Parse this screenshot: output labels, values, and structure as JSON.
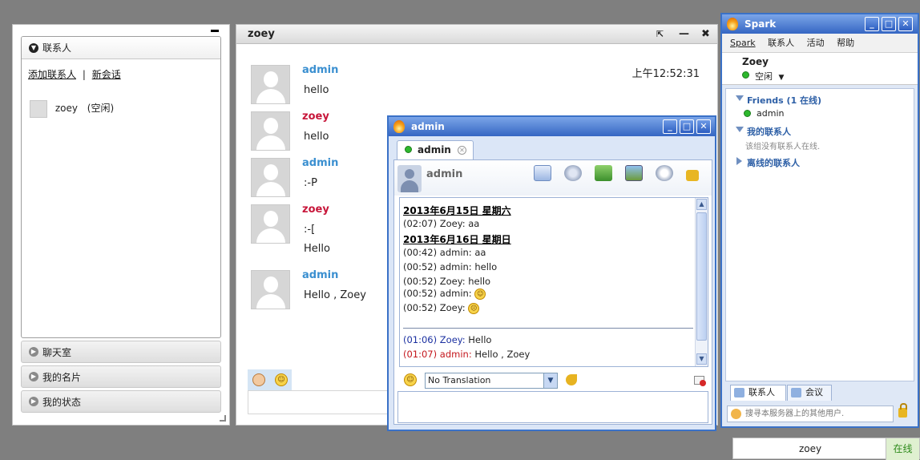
{
  "left_panel": {
    "contacts_header": "联系人",
    "add_contact_link": "添加联系人",
    "separator": "|",
    "new_session_link": "新会话",
    "contact": {
      "name": "zoey",
      "status": "(空闲)"
    },
    "sections": [
      "聊天室",
      "我的名片",
      "我的状态"
    ]
  },
  "chat_window": {
    "title": "zoey",
    "popout_icon": "⇱",
    "minimize_icon": "—",
    "close_icon": "✖",
    "first_time": "上午12:52:31",
    "messages": [
      {
        "sender": "admin",
        "lines": [
          "hello"
        ]
      },
      {
        "sender": "zoey",
        "lines": [
          "hello"
        ]
      },
      {
        "sender": "admin",
        "lines": [
          ":-P"
        ]
      },
      {
        "sender": "zoey",
        "lines": [
          ":-[",
          "Hello"
        ]
      },
      {
        "sender": "admin",
        "lines": [
          "Hello , Zoey"
        ]
      }
    ]
  },
  "spark": {
    "title": "Spark",
    "menu": [
      "Spark",
      "联系人",
      "活动",
      "帮助"
    ],
    "user": {
      "name": "Zoey",
      "status": "空闲"
    },
    "groups": [
      {
        "name": "Friends (1 在线)",
        "members": [
          "admin"
        ]
      },
      {
        "name": "我的联系人",
        "note": "该组没有联系人在线."
      },
      {
        "name": "离线的联系人"
      }
    ],
    "tabs": [
      "联系人",
      "会议"
    ],
    "search_placeholder": "搜寻本服务器上的其他用户."
  },
  "admin_dialog": {
    "title": "admin",
    "tab_label": "admin",
    "header_name": "admin",
    "transcript": [
      {
        "type": "date",
        "text": "2013年6月15日 星期六"
      },
      {
        "type": "line",
        "text": "(02:07) Zoey: aa"
      },
      {
        "type": "date",
        "text": "2013年6月16日 星期日"
      },
      {
        "type": "line",
        "text": "(00:42) admin: aa"
      },
      {
        "type": "line",
        "text": "(00:52) admin: hello"
      },
      {
        "type": "line",
        "text": "(00:52) Zoey: hello"
      },
      {
        "type": "line",
        "text": "(00:52) admin:"
      },
      {
        "type": "line",
        "text": "(00:52) Zoey:"
      }
    ],
    "live": [
      {
        "time": "(01:06)",
        "who": "Zoey:",
        "text": "Hello",
        "color": "#1a2fa0"
      },
      {
        "time": "(01:07)",
        "who": "admin:",
        "text": "Hello , Zoey",
        "color": "#c4161c"
      }
    ],
    "translation": "No Translation"
  },
  "bottom_widget": {
    "name": "zoey",
    "status": "在线"
  },
  "colors": {
    "accent_blue": "#3a71c7",
    "admin_name": "#3a8fd0",
    "zoey_name": "#c7163a",
    "online": "#2db82d"
  }
}
